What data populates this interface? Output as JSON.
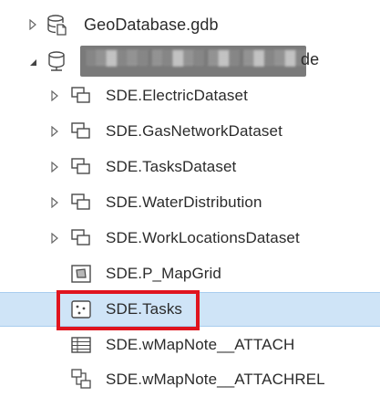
{
  "tree": {
    "items": [
      {
        "label": "GeoDatabase.gdb",
        "icon": "file-geodatabase-icon",
        "expander": "collapsed",
        "level": 0
      },
      {
        "label": "de",
        "icon": "enterprise-geodatabase-icon",
        "expander": "expanded",
        "level": 0,
        "obscured": true
      },
      {
        "label": "SDE.ElectricDataset",
        "icon": "feature-dataset-icon",
        "expander": "collapsed",
        "level": 1
      },
      {
        "label": "SDE.GasNetworkDataset",
        "icon": "feature-dataset-icon",
        "expander": "collapsed",
        "level": 1
      },
      {
        "label": "SDE.TasksDataset",
        "icon": "feature-dataset-icon",
        "expander": "collapsed",
        "level": 1
      },
      {
        "label": "SDE.WaterDistribution",
        "icon": "feature-dataset-icon",
        "expander": "collapsed",
        "level": 1
      },
      {
        "label": "SDE.WorkLocationsDataset",
        "icon": "feature-dataset-icon",
        "expander": "collapsed",
        "level": 1
      },
      {
        "label": "SDE.P_MapGrid",
        "icon": "polygon-feature-class-icon",
        "expander": "none",
        "level": 1
      },
      {
        "label": "SDE.Tasks",
        "icon": "point-feature-class-icon",
        "expander": "none",
        "level": 1,
        "selected": true
      },
      {
        "label": "SDE.wMapNote__ATTACH",
        "icon": "table-icon",
        "expander": "none",
        "level": 1
      },
      {
        "label": "SDE.wMapNote__ATTACHREL",
        "icon": "relationship-class-icon",
        "expander": "none",
        "level": 1
      }
    ]
  },
  "colors": {
    "selection_background": "#cfe4f7",
    "highlight_border": "#e0141e",
    "text": "#2b2b2b",
    "icon_stroke": "#4a4a4a"
  }
}
